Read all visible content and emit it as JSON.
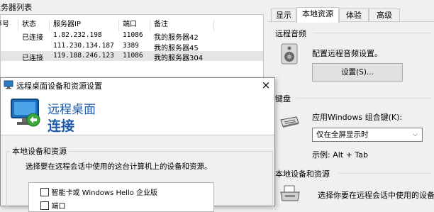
{
  "server_list": {
    "title": "服务器列表",
    "columns": [
      "序号",
      "状态",
      "服务器IP",
      "端口",
      "备注"
    ],
    "rows": [
      {
        "num": "",
        "status": "已连接",
        "ip": "1.82.232.198",
        "port": "11086",
        "note": "我的服务器42"
      },
      {
        "num": "",
        "status": "",
        "ip": "111.230.134.187",
        "port": "3389",
        "note": "我的服务器45"
      },
      {
        "num": "",
        "status": "已连接",
        "ip": "119.188.246.123",
        "port": "11086",
        "note": "我的服务器304"
      }
    ]
  },
  "right_panel": {
    "tabs": [
      {
        "label": "显示",
        "active": false
      },
      {
        "label": "本地资源",
        "active": true
      },
      {
        "label": "体验",
        "active": false
      },
      {
        "label": "高级",
        "active": false
      }
    ],
    "audio": {
      "section": "远程音频",
      "desc": "配置远程音频设置。",
      "button": "设置(S)..."
    },
    "keyboard": {
      "section": "键盘",
      "desc": "应用Windows 组合键(K):",
      "selected": "仅在全屏显示时",
      "example": "示例: Alt + Tab"
    },
    "local": {
      "section": "本地设备和资源",
      "desc": "选择你要在远程会话中使用的设备和"
    }
  },
  "dialog": {
    "title": "远程桌面设备和资源设置",
    "close": "×",
    "banner_line1": "远程桌面",
    "banner_line2": "连接",
    "group_label": "本地设备和资源",
    "instruction": "选择要在远程会话中使用的这台计算机上的设备和资源。",
    "checkboxes": [
      {
        "label": "智能卡或 Windows Hello 企业版",
        "checked": false
      },
      {
        "label": "端口",
        "checked": false
      }
    ]
  },
  "colors": {
    "accent": "#0078d7",
    "banner_text": "#1e5aa8",
    "selected_row": "#e5e5e5"
  }
}
